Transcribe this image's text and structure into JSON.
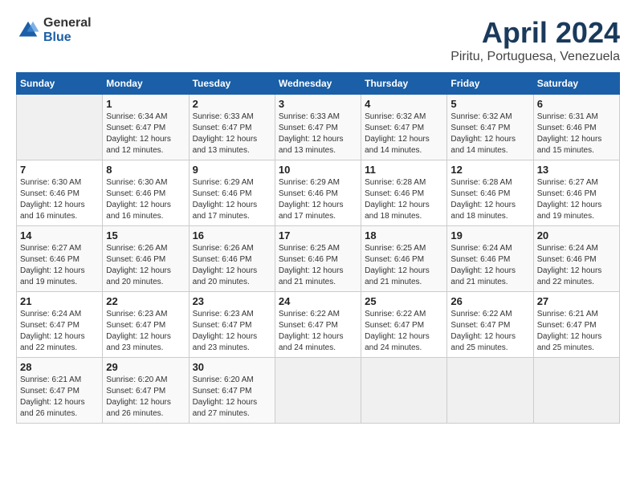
{
  "header": {
    "logo_general": "General",
    "logo_blue": "Blue",
    "title": "April 2024",
    "subtitle": "Piritu, Portuguesa, Venezuela"
  },
  "calendar": {
    "days_of_week": [
      "Sunday",
      "Monday",
      "Tuesday",
      "Wednesday",
      "Thursday",
      "Friday",
      "Saturday"
    ],
    "weeks": [
      [
        {
          "day": "",
          "info": ""
        },
        {
          "day": "1",
          "info": "Sunrise: 6:34 AM\nSunset: 6:47 PM\nDaylight: 12 hours\nand 12 minutes."
        },
        {
          "day": "2",
          "info": "Sunrise: 6:33 AM\nSunset: 6:47 PM\nDaylight: 12 hours\nand 13 minutes."
        },
        {
          "day": "3",
          "info": "Sunrise: 6:33 AM\nSunset: 6:47 PM\nDaylight: 12 hours\nand 13 minutes."
        },
        {
          "day": "4",
          "info": "Sunrise: 6:32 AM\nSunset: 6:47 PM\nDaylight: 12 hours\nand 14 minutes."
        },
        {
          "day": "5",
          "info": "Sunrise: 6:32 AM\nSunset: 6:47 PM\nDaylight: 12 hours\nand 14 minutes."
        },
        {
          "day": "6",
          "info": "Sunrise: 6:31 AM\nSunset: 6:46 PM\nDaylight: 12 hours\nand 15 minutes."
        }
      ],
      [
        {
          "day": "7",
          "info": "Sunrise: 6:30 AM\nSunset: 6:46 PM\nDaylight: 12 hours\nand 16 minutes."
        },
        {
          "day": "8",
          "info": "Sunrise: 6:30 AM\nSunset: 6:46 PM\nDaylight: 12 hours\nand 16 minutes."
        },
        {
          "day": "9",
          "info": "Sunrise: 6:29 AM\nSunset: 6:46 PM\nDaylight: 12 hours\nand 17 minutes."
        },
        {
          "day": "10",
          "info": "Sunrise: 6:29 AM\nSunset: 6:46 PM\nDaylight: 12 hours\nand 17 minutes."
        },
        {
          "day": "11",
          "info": "Sunrise: 6:28 AM\nSunset: 6:46 PM\nDaylight: 12 hours\nand 18 minutes."
        },
        {
          "day": "12",
          "info": "Sunrise: 6:28 AM\nSunset: 6:46 PM\nDaylight: 12 hours\nand 18 minutes."
        },
        {
          "day": "13",
          "info": "Sunrise: 6:27 AM\nSunset: 6:46 PM\nDaylight: 12 hours\nand 19 minutes."
        }
      ],
      [
        {
          "day": "14",
          "info": "Sunrise: 6:27 AM\nSunset: 6:46 PM\nDaylight: 12 hours\nand 19 minutes."
        },
        {
          "day": "15",
          "info": "Sunrise: 6:26 AM\nSunset: 6:46 PM\nDaylight: 12 hours\nand 20 minutes."
        },
        {
          "day": "16",
          "info": "Sunrise: 6:26 AM\nSunset: 6:46 PM\nDaylight: 12 hours\nand 20 minutes."
        },
        {
          "day": "17",
          "info": "Sunrise: 6:25 AM\nSunset: 6:46 PM\nDaylight: 12 hours\nand 21 minutes."
        },
        {
          "day": "18",
          "info": "Sunrise: 6:25 AM\nSunset: 6:46 PM\nDaylight: 12 hours\nand 21 minutes."
        },
        {
          "day": "19",
          "info": "Sunrise: 6:24 AM\nSunset: 6:46 PM\nDaylight: 12 hours\nand 21 minutes."
        },
        {
          "day": "20",
          "info": "Sunrise: 6:24 AM\nSunset: 6:46 PM\nDaylight: 12 hours\nand 22 minutes."
        }
      ],
      [
        {
          "day": "21",
          "info": "Sunrise: 6:24 AM\nSunset: 6:47 PM\nDaylight: 12 hours\nand 22 minutes."
        },
        {
          "day": "22",
          "info": "Sunrise: 6:23 AM\nSunset: 6:47 PM\nDaylight: 12 hours\nand 23 minutes."
        },
        {
          "day": "23",
          "info": "Sunrise: 6:23 AM\nSunset: 6:47 PM\nDaylight: 12 hours\nand 23 minutes."
        },
        {
          "day": "24",
          "info": "Sunrise: 6:22 AM\nSunset: 6:47 PM\nDaylight: 12 hours\nand 24 minutes."
        },
        {
          "day": "25",
          "info": "Sunrise: 6:22 AM\nSunset: 6:47 PM\nDaylight: 12 hours\nand 24 minutes."
        },
        {
          "day": "26",
          "info": "Sunrise: 6:22 AM\nSunset: 6:47 PM\nDaylight: 12 hours\nand 25 minutes."
        },
        {
          "day": "27",
          "info": "Sunrise: 6:21 AM\nSunset: 6:47 PM\nDaylight: 12 hours\nand 25 minutes."
        }
      ],
      [
        {
          "day": "28",
          "info": "Sunrise: 6:21 AM\nSunset: 6:47 PM\nDaylight: 12 hours\nand 26 minutes."
        },
        {
          "day": "29",
          "info": "Sunrise: 6:20 AM\nSunset: 6:47 PM\nDaylight: 12 hours\nand 26 minutes."
        },
        {
          "day": "30",
          "info": "Sunrise: 6:20 AM\nSunset: 6:47 PM\nDaylight: 12 hours\nand 27 minutes."
        },
        {
          "day": "",
          "info": ""
        },
        {
          "day": "",
          "info": ""
        },
        {
          "day": "",
          "info": ""
        },
        {
          "day": "",
          "info": ""
        }
      ]
    ]
  }
}
